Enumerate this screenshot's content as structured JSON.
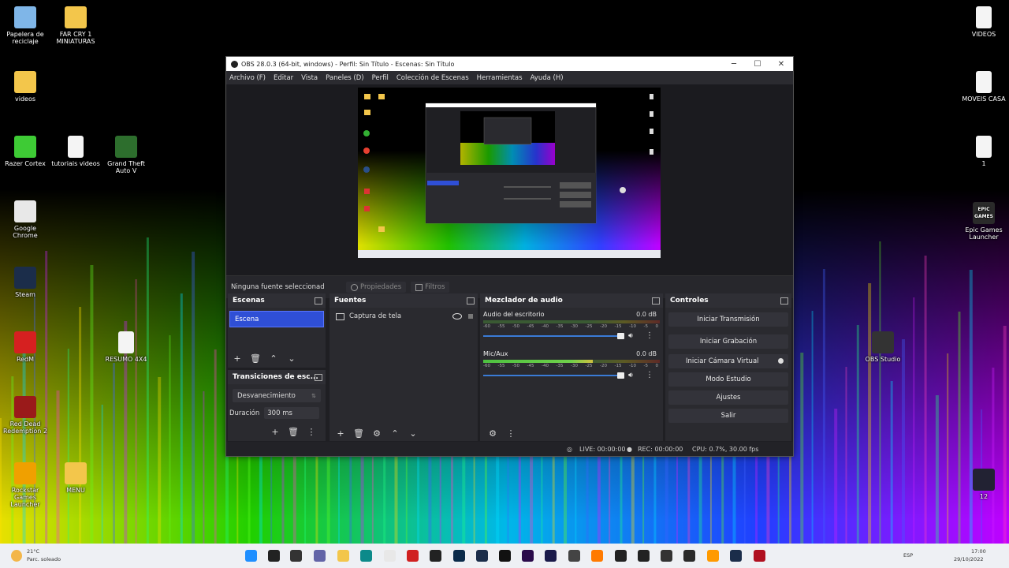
{
  "desktop": {
    "left_icons": [
      {
        "label": "Papelera de reciclaje",
        "icon": "recycle-bin-icon"
      },
      {
        "label": "FAR CRY 1 MINIATURAS",
        "icon": "folder-icon"
      },
      {
        "label": "videos",
        "icon": "folder-icon"
      },
      {
        "label": "Razer Cortex",
        "icon": "razer-cortex-icon"
      },
      {
        "label": "tutoriais videos",
        "icon": "file-icon"
      },
      {
        "label": "Grand Theft Auto V",
        "icon": "gta-v-icon"
      },
      {
        "label": "Google Chrome",
        "icon": "chrome-icon"
      },
      {
        "label": "Steam",
        "icon": "steam-icon"
      },
      {
        "label": "RedM",
        "icon": "redm-icon"
      },
      {
        "label": "RESUMO 4X4",
        "icon": "file-icon"
      },
      {
        "label": "Red Dead Redemption 2",
        "icon": "rdr2-icon"
      },
      {
        "label": "Rockstar Games Launcher",
        "icon": "rockstar-icon"
      },
      {
        "label": "MENU",
        "icon": "folder-icon"
      }
    ],
    "right_icons": [
      {
        "label": "VIDEOS",
        "icon": "file-icon"
      },
      {
        "label": "MOVEIS CASA",
        "icon": "file-icon"
      },
      {
        "label": "1",
        "icon": "file-icon"
      },
      {
        "label": "Epic Games Launcher",
        "icon": "epic-games-icon",
        "logo_text": "EPIC GAMES"
      },
      {
        "label": "OBS Studio",
        "icon": "obs-studio-icon"
      },
      {
        "label": "12",
        "icon": "image-file-icon"
      }
    ]
  },
  "window": {
    "title": "OBS 28.0.3 (64-bit, windows) - Perfil: Sin Título - Escenas: Sin Título",
    "controls": [
      "─",
      "☐",
      "✕"
    ],
    "menu": [
      "Archivo (F)",
      "Editar",
      "Vista",
      "Paneles (D)",
      "Perfil",
      "Colección de Escenas",
      "Herramientas",
      "Ayuda (H)"
    ]
  },
  "source_bar": {
    "no_source": "Ninguna fuente seleccionad",
    "properties": "Propiedades",
    "filters": "Filtros"
  },
  "scenes": {
    "title": "Escenas",
    "items": [
      "Escena"
    ]
  },
  "transitions": {
    "title": "Transiciones de esc...",
    "type": "Desvanecimiento",
    "duration_label": "Duración",
    "duration_value": "300 ms"
  },
  "sources": {
    "title": "Fuentes",
    "items": [
      "Captura de tela"
    ]
  },
  "mixer": {
    "title": "Mezclador de audio",
    "ticks": [
      "-60",
      "-55",
      "-50",
      "-45",
      "-40",
      "-35",
      "-30",
      "-25",
      "-20",
      "-15",
      "-10",
      "-5",
      "0"
    ],
    "channels": [
      {
        "name": "Audio del escritorio",
        "db": "0.0 dB",
        "level": 0.0
      },
      {
        "name": "Mic/Aux",
        "db": "0.0 dB",
        "level": 0.62
      }
    ]
  },
  "controls": {
    "title": "Controles",
    "buttons": [
      "Iniciar Transmisión",
      "Iniciar Grabación",
      "Iniciar Cámara Virtual",
      "Modo Estudio",
      "Ajustes",
      "Salir"
    ]
  },
  "status": {
    "live": "LIVE: 00:00:00",
    "rec": "REC: 00:00:00",
    "cpu": "CPU: 0.7%, 30.00 fps"
  },
  "taskbar": {
    "weather_temp": "21°C",
    "weather_desc": "Parc. soleado",
    "lang": "ESP",
    "time": "17:00",
    "date": "29/10/2022"
  }
}
